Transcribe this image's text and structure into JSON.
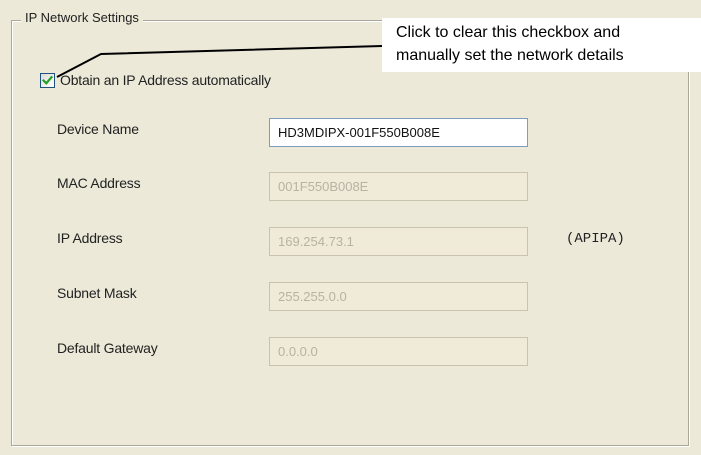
{
  "group": {
    "title": "IP Network Settings"
  },
  "auto_ip": {
    "label": "Obtain an IP Address automatically",
    "checked": true
  },
  "callout": {
    "line1": "Click to clear this checkbox and",
    "line2": "manually set the network details"
  },
  "fields": {
    "device_name": {
      "label": "Device Name",
      "value": "HD3MDIPX-001F550B008E",
      "enabled": true
    },
    "mac_address": {
      "label": "MAC Address",
      "value": "001F550B008E",
      "enabled": false
    },
    "ip_address": {
      "label": "IP Address",
      "value": "169.254.73.1",
      "enabled": false,
      "note": "(APIPA)"
    },
    "subnet_mask": {
      "label": "Subnet Mask",
      "value": "255.255.0.0",
      "enabled": false
    },
    "default_gateway": {
      "label": "Default Gateway",
      "value": "0.0.0.0",
      "enabled": false
    }
  },
  "icons": {
    "checkbox_mark": "checkmark-icon"
  },
  "colors": {
    "check": "#21a121",
    "disabled_field_bg": "#f0ead8",
    "panel_bg": "#ece9d8"
  }
}
